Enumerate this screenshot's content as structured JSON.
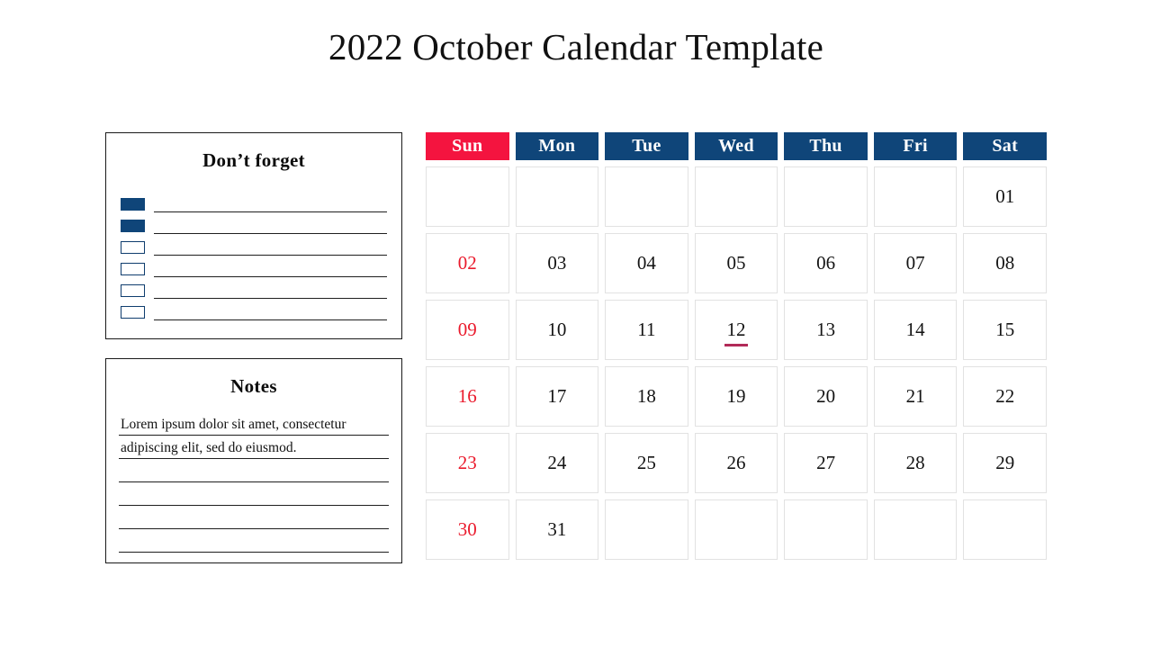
{
  "title": "2022 October Calendar Template",
  "dont_forget": {
    "heading": "Don’t forget",
    "items": [
      {
        "checked": true,
        "text": ""
      },
      {
        "checked": true,
        "text": ""
      },
      {
        "checked": false,
        "text": ""
      },
      {
        "checked": false,
        "text": ""
      },
      {
        "checked": false,
        "text": ""
      },
      {
        "checked": false,
        "text": ""
      }
    ]
  },
  "notes": {
    "heading": "Notes",
    "lines": [
      "Lorem ipsum dolor sit amet, consectetur",
      "adipiscing elit, sed do eiusmod.",
      "",
      "",
      "",
      ""
    ]
  },
  "calendar": {
    "month": "October",
    "year": "2022",
    "weekday_headers": [
      "Sun",
      "Mon",
      "Tue",
      "Wed",
      "Thu",
      "Fri",
      "Sat"
    ],
    "highlighted_date": "12",
    "colors": {
      "header_weekday": "#0f4579",
      "header_sunday": "#f4143f",
      "sunday_date": "#ea1b2d",
      "highlight_underline": "#b22a58",
      "cell_border": "#e2e2e2",
      "checkbox": "#0f4579"
    },
    "weeks": [
      [
        {
          "date": "",
          "sunday": false,
          "marked": false
        },
        {
          "date": "",
          "sunday": false,
          "marked": false
        },
        {
          "date": "",
          "sunday": false,
          "marked": false
        },
        {
          "date": "",
          "sunday": false,
          "marked": false
        },
        {
          "date": "",
          "sunday": false,
          "marked": false
        },
        {
          "date": "",
          "sunday": false,
          "marked": false
        },
        {
          "date": "01",
          "sunday": false,
          "marked": false
        }
      ],
      [
        {
          "date": "02",
          "sunday": true,
          "marked": false
        },
        {
          "date": "03",
          "sunday": false,
          "marked": false
        },
        {
          "date": "04",
          "sunday": false,
          "marked": false
        },
        {
          "date": "05",
          "sunday": false,
          "marked": false
        },
        {
          "date": "06",
          "sunday": false,
          "marked": false
        },
        {
          "date": "07",
          "sunday": false,
          "marked": false
        },
        {
          "date": "08",
          "sunday": false,
          "marked": false
        }
      ],
      [
        {
          "date": "09",
          "sunday": true,
          "marked": false
        },
        {
          "date": "10",
          "sunday": false,
          "marked": false
        },
        {
          "date": "11",
          "sunday": false,
          "marked": false
        },
        {
          "date": "12",
          "sunday": false,
          "marked": true
        },
        {
          "date": "13",
          "sunday": false,
          "marked": false
        },
        {
          "date": "14",
          "sunday": false,
          "marked": false
        },
        {
          "date": "15",
          "sunday": false,
          "marked": false
        }
      ],
      [
        {
          "date": "16",
          "sunday": true,
          "marked": false
        },
        {
          "date": "17",
          "sunday": false,
          "marked": false
        },
        {
          "date": "18",
          "sunday": false,
          "marked": false
        },
        {
          "date": "19",
          "sunday": false,
          "marked": false
        },
        {
          "date": "20",
          "sunday": false,
          "marked": false
        },
        {
          "date": "21",
          "sunday": false,
          "marked": false
        },
        {
          "date": "22",
          "sunday": false,
          "marked": false
        }
      ],
      [
        {
          "date": "23",
          "sunday": true,
          "marked": false
        },
        {
          "date": "24",
          "sunday": false,
          "marked": false
        },
        {
          "date": "25",
          "sunday": false,
          "marked": false
        },
        {
          "date": "26",
          "sunday": false,
          "marked": false
        },
        {
          "date": "27",
          "sunday": false,
          "marked": false
        },
        {
          "date": "28",
          "sunday": false,
          "marked": false
        },
        {
          "date": "29",
          "sunday": false,
          "marked": false
        }
      ],
      [
        {
          "date": "30",
          "sunday": true,
          "marked": false
        },
        {
          "date": "31",
          "sunday": false,
          "marked": false
        },
        {
          "date": "",
          "sunday": false,
          "marked": false
        },
        {
          "date": "",
          "sunday": false,
          "marked": false
        },
        {
          "date": "",
          "sunday": false,
          "marked": false
        },
        {
          "date": "",
          "sunday": false,
          "marked": false
        },
        {
          "date": "",
          "sunday": false,
          "marked": false
        }
      ]
    ]
  }
}
